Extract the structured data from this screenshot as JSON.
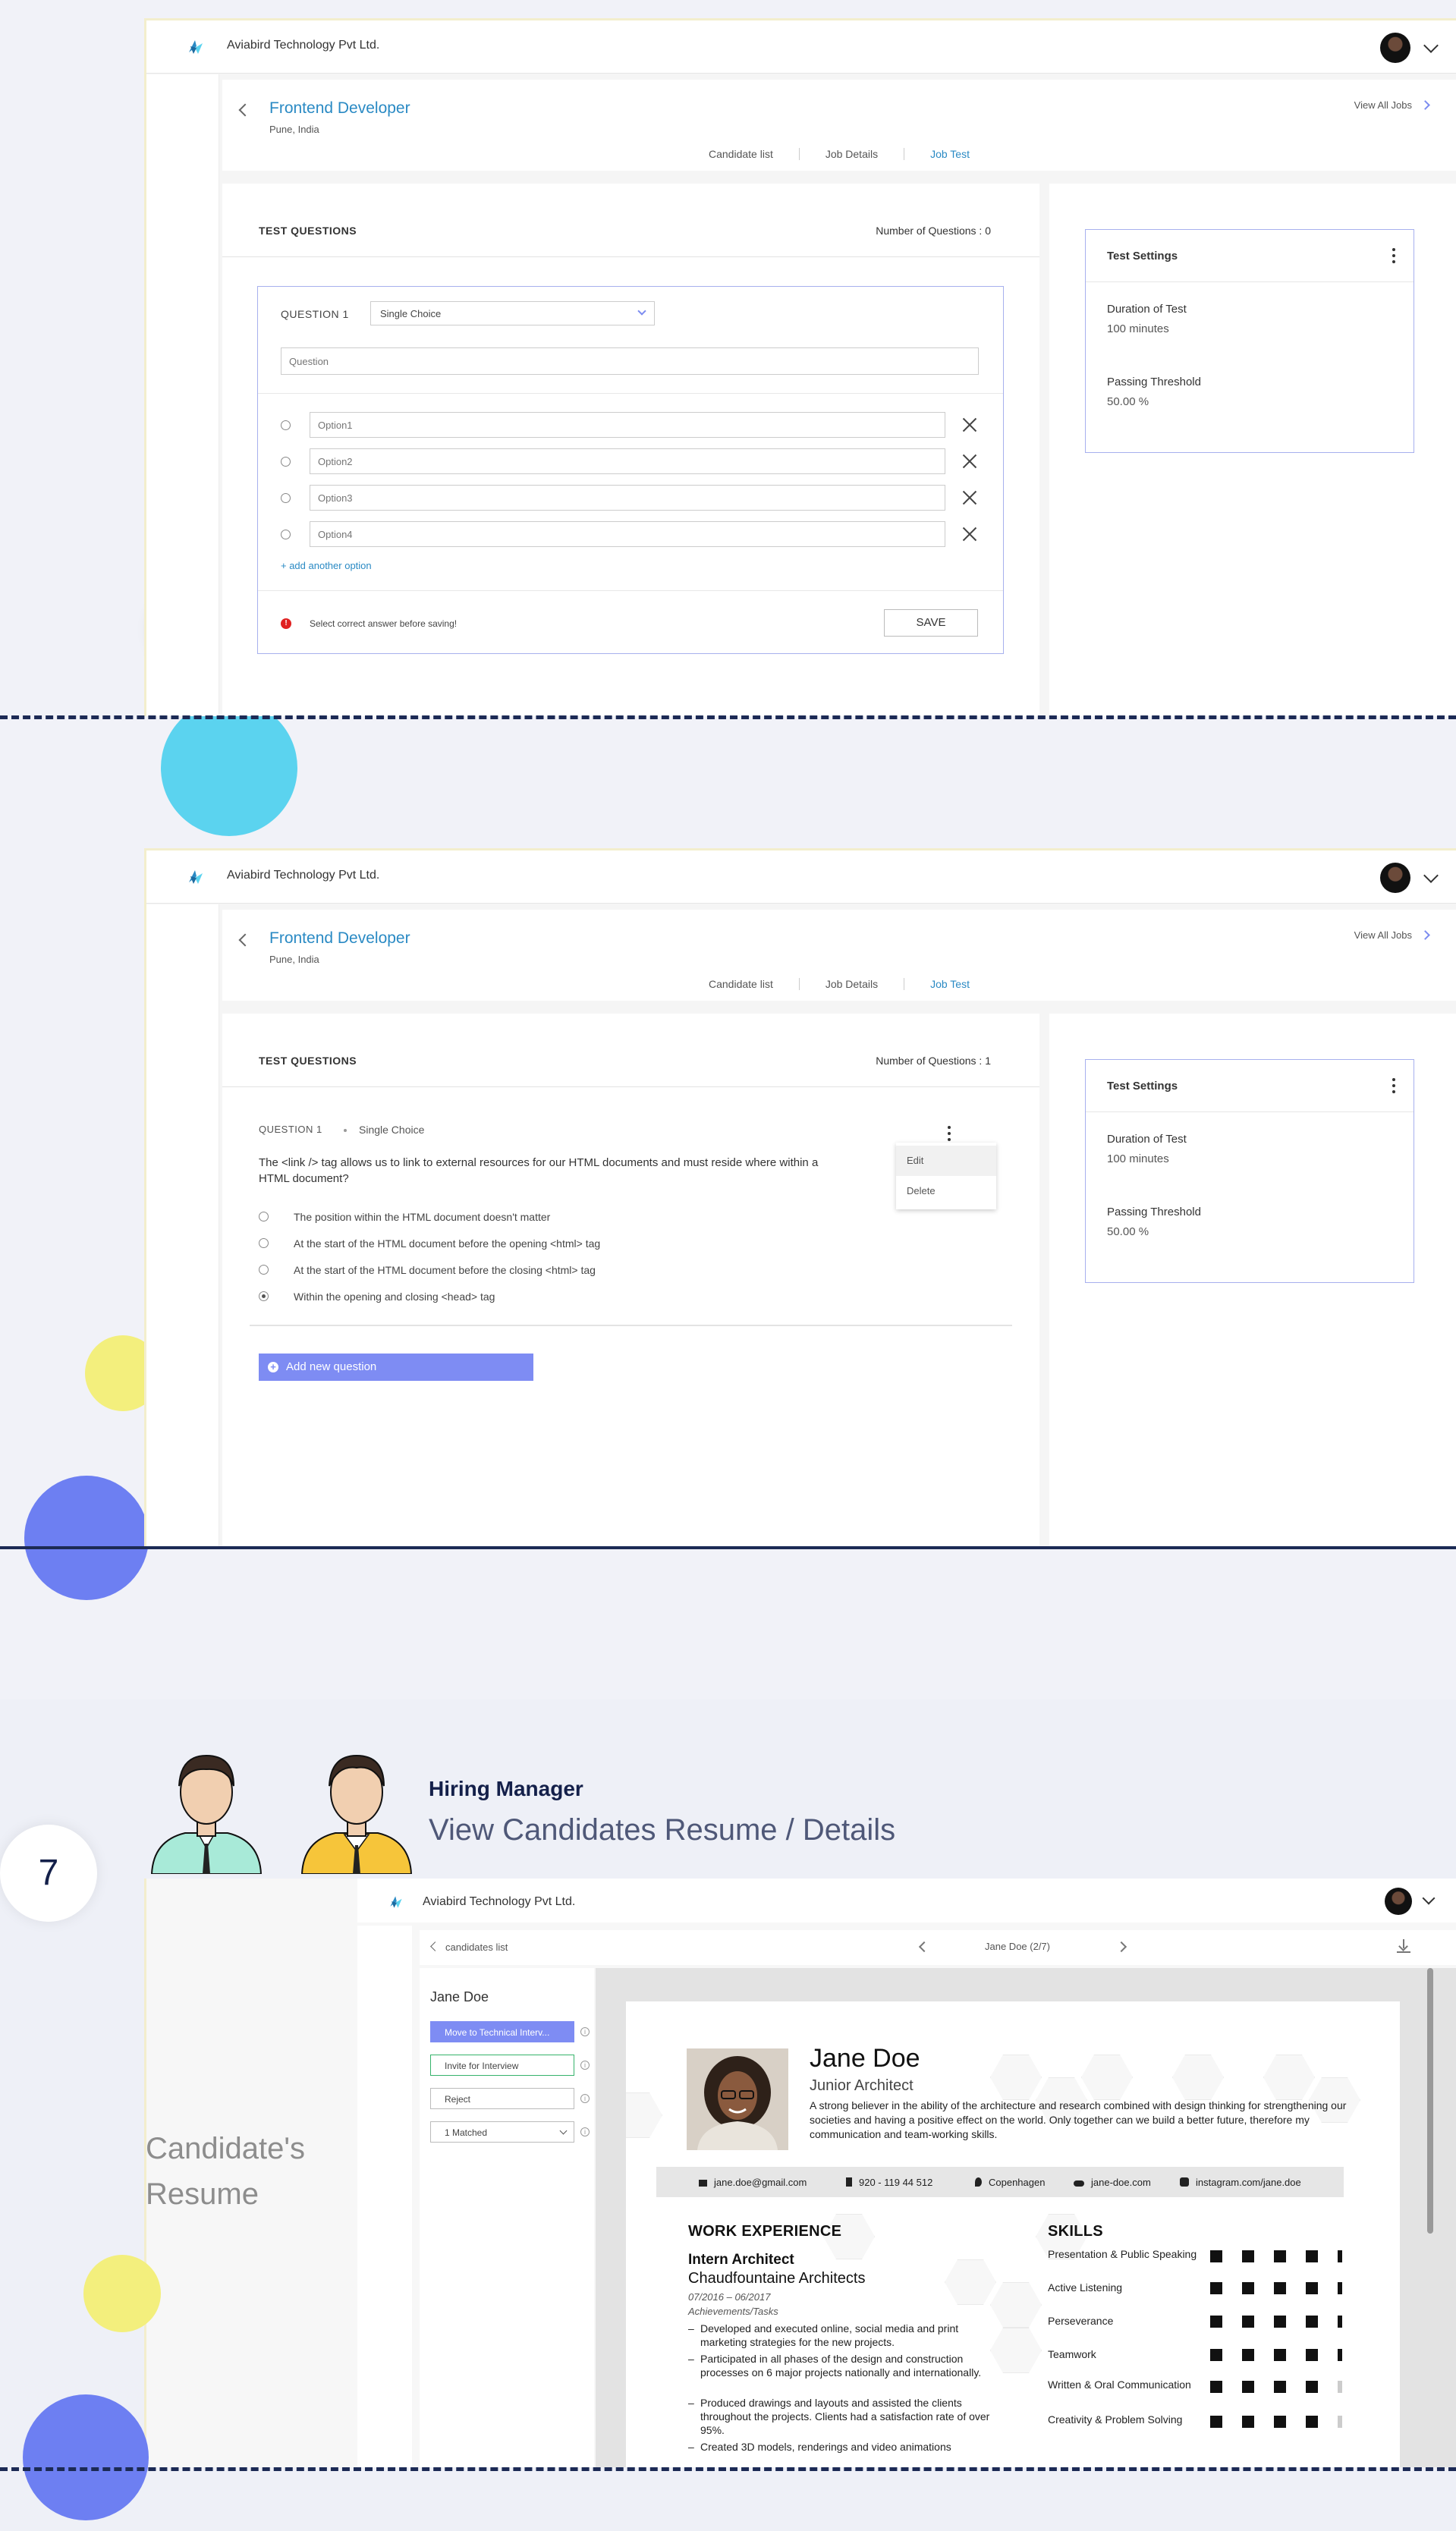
{
  "app": {
    "company": "Aviabird Technology Pvt Ltd."
  },
  "job": {
    "title": "Frontend Developer",
    "location": "Pune, India",
    "view_all": "View All Jobs",
    "tabs": [
      {
        "label": "Candidate list"
      },
      {
        "label": "Job Details"
      },
      {
        "label": "Job Test"
      }
    ]
  },
  "screen1": {
    "section_title": "TEST QUESTIONS",
    "num_questions": "Number of Questions  :  0",
    "question_label": "QUESTION 1",
    "question_type": "Single Choice",
    "question_placeholder": "Question",
    "options": [
      {
        "placeholder": "Option1"
      },
      {
        "placeholder": "Option2"
      },
      {
        "placeholder": "Option3"
      },
      {
        "placeholder": "Option4"
      }
    ],
    "add_option": "+ add another option",
    "error": "Select correct answer before saving!",
    "save": "SAVE"
  },
  "settings": {
    "title": "Test Settings",
    "duration_label": "Duration of Test",
    "duration_value": "100 minutes",
    "threshold_label": "Passing Threshold",
    "threshold_value": "50.00  %"
  },
  "screen2": {
    "section_title": "TEST QUESTIONS",
    "num_questions": "Number of Questions  :  1",
    "question_label": "QUESTION 1",
    "question_type": "Single Choice",
    "question_text": "The <link /> tag allows us to link to external resources for our HTML documents and must reside where within a HTML document?",
    "answers": [
      {
        "text": "The position within the HTML document doesn't matter",
        "selected": false
      },
      {
        "text": "At the start of the HTML document before the opening <html> tag",
        "selected": false
      },
      {
        "text": "At the start of the HTML document before the closing <html> tag",
        "selected": false
      },
      {
        "text": "Within the opening and closing <head> tag",
        "selected": true
      }
    ],
    "menu": {
      "edit": "Edit",
      "delete": "Delete"
    },
    "add_question": "Add new question"
  },
  "section3": {
    "step": "7",
    "role": "Hiring Manager",
    "title": "View Candidates Resume / Details",
    "left_label_1": "Candidate's",
    "left_label_2": "Resume"
  },
  "candidate": {
    "back_label": "candidates list",
    "pager": "Jane Doe (2/7)",
    "name": "Jane Doe",
    "actions": [
      {
        "label": "Move to Technical Interv..."
      },
      {
        "label": "Invite for Interview"
      },
      {
        "label": "Reject"
      },
      {
        "label": "1   Matched"
      }
    ]
  },
  "resume": {
    "name": "Jane Doe",
    "role": "Junior Architect",
    "summary": "A strong believer in the ability of the architecture and research combined with design thinking for strengthening our societies and having a positive effect on the world. Only together can we build a better future, therefore my communication and team-working skills.",
    "contacts": [
      {
        "text": "jane.doe@gmail.com"
      },
      {
        "text": "920 - 119 44 512"
      },
      {
        "text": "Copenhagen"
      },
      {
        "text": "jane-doe.com"
      },
      {
        "text": "instagram.com/jane.doe"
      }
    ],
    "work_heading": "WORK EXPERIENCE",
    "job_title": "Intern Architect",
    "job_company": "Chaudfountaine Architects",
    "job_dates": "07/2016 – 06/2017",
    "job_achievements": "Achievements/Tasks",
    "bullets": [
      {
        "text": "Developed and executed online, social media and print marketing strategies for the new projects."
      },
      {
        "text": "Participated in all phases of the design and construction processes on 6 major projects nationally and internationally."
      },
      {
        "text": "Produced drawings and layouts and assisted the clients throughout the projects. Clients had a satisfaction rate of over 95%."
      },
      {
        "text": "Created 3D models, renderings and video animations"
      }
    ],
    "skills_heading": "SKILLS",
    "skills": [
      {
        "name": "Presentation & Public Speaking",
        "level": 5
      },
      {
        "name": "Active Listening",
        "level": 5
      },
      {
        "name": "Perseverance",
        "level": 5
      },
      {
        "name": "Teamwork",
        "level": 5
      },
      {
        "name": "Written & Oral Communication",
        "level": 4
      },
      {
        "name": "Creativity & Problem Solving",
        "level": 4
      }
    ]
  },
  "colors": {
    "accent": "#7e8cf3",
    "link": "#2a8ac4",
    "cyan_circle": "#5bd3ef",
    "yellow_circle": "#f3ef7d",
    "navy": "#1c2a55"
  }
}
